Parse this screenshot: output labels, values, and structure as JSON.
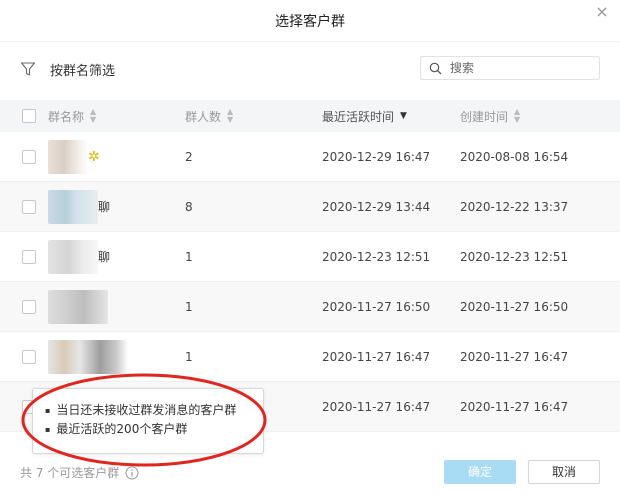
{
  "dialog": {
    "title": "选择客户群",
    "close_glyph": "×"
  },
  "filter": {
    "label": "按群名筛选"
  },
  "search": {
    "placeholder": "搜索"
  },
  "columns": {
    "name": "群名称",
    "count": "群人数",
    "active": "最近活跃时间",
    "created": "创建时间"
  },
  "rows": [
    {
      "name": "",
      "name_glyph": "✲",
      "count": "2",
      "active": "2020-12-29 16:47",
      "created": "2020-08-08 16:54"
    },
    {
      "name": "聊",
      "name_glyph": "",
      "count": "8",
      "active": "2020-12-29 13:44",
      "created": "2020-12-22 13:37"
    },
    {
      "name": "聊",
      "name_glyph": "",
      "count": "1",
      "active": "2020-12-23 12:51",
      "created": "2020-12-23 12:51"
    },
    {
      "name": "",
      "name_glyph": "",
      "count": "1",
      "active": "2020-11-27 16:50",
      "created": "2020-11-27 16:50"
    },
    {
      "name": "",
      "name_glyph": "",
      "count": "1",
      "active": "2020-11-27 16:47",
      "created": "2020-11-27 16:47"
    },
    {
      "name": "",
      "name_glyph": "",
      "count": "",
      "active": "2020-11-27 16:47",
      "created": "2020-11-27 16:47"
    }
  ],
  "tooltip": {
    "line1": "当日还未接收过群发消息的客户群",
    "line2": "最近活跃的200个客户群"
  },
  "footer": {
    "count_text": "共 7 个可选客户群",
    "confirm": "确定",
    "cancel": "取消"
  },
  "colors": {
    "accent_disabled": "#a8dcf5",
    "annotation": "#e0261f",
    "header_bg": "#f4f5f7"
  }
}
